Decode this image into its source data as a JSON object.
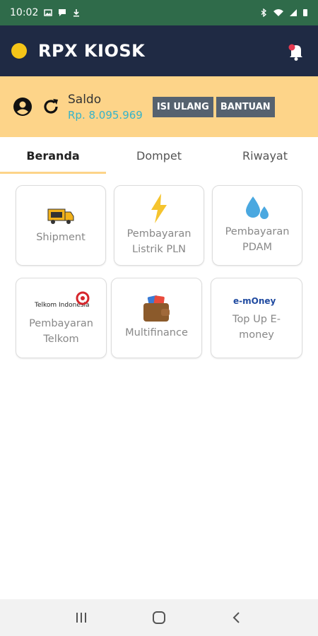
{
  "status": {
    "time": "10:02"
  },
  "app": {
    "title": "RPX KIOSK"
  },
  "saldo": {
    "label": "Saldo",
    "value": "Rp. 8.095.969",
    "topup_label": "ISI ULANG",
    "help_label": "BANTUAN"
  },
  "tabs": [
    {
      "label": "Beranda",
      "active": true
    },
    {
      "label": "Dompet",
      "active": false
    },
    {
      "label": "Riwayat",
      "active": false
    }
  ],
  "menu": [
    {
      "label": "Shipment",
      "icon": "truck-icon"
    },
    {
      "label": "Pembayaran Listrik PLN",
      "icon": "lightning-icon"
    },
    {
      "label": "Pembayaran PDAM",
      "icon": "water-drops-icon"
    },
    {
      "label": "Pembayaran Telkom",
      "icon": "telkom-logo",
      "logo_text": "Telkom Indonesia"
    },
    {
      "label": "Multifinance",
      "icon": "wallet-icon"
    },
    {
      "label": "Top Up E-money",
      "icon": "emoney-logo",
      "logo_text": "e-mOney"
    }
  ],
  "colors": {
    "statusbar": "#2f6b4a",
    "appbar": "#1f2a44",
    "saldo_bg": "#fdd489",
    "saldo_value": "#36b3c9",
    "button": "#56626f",
    "logo": "#f5c518"
  }
}
